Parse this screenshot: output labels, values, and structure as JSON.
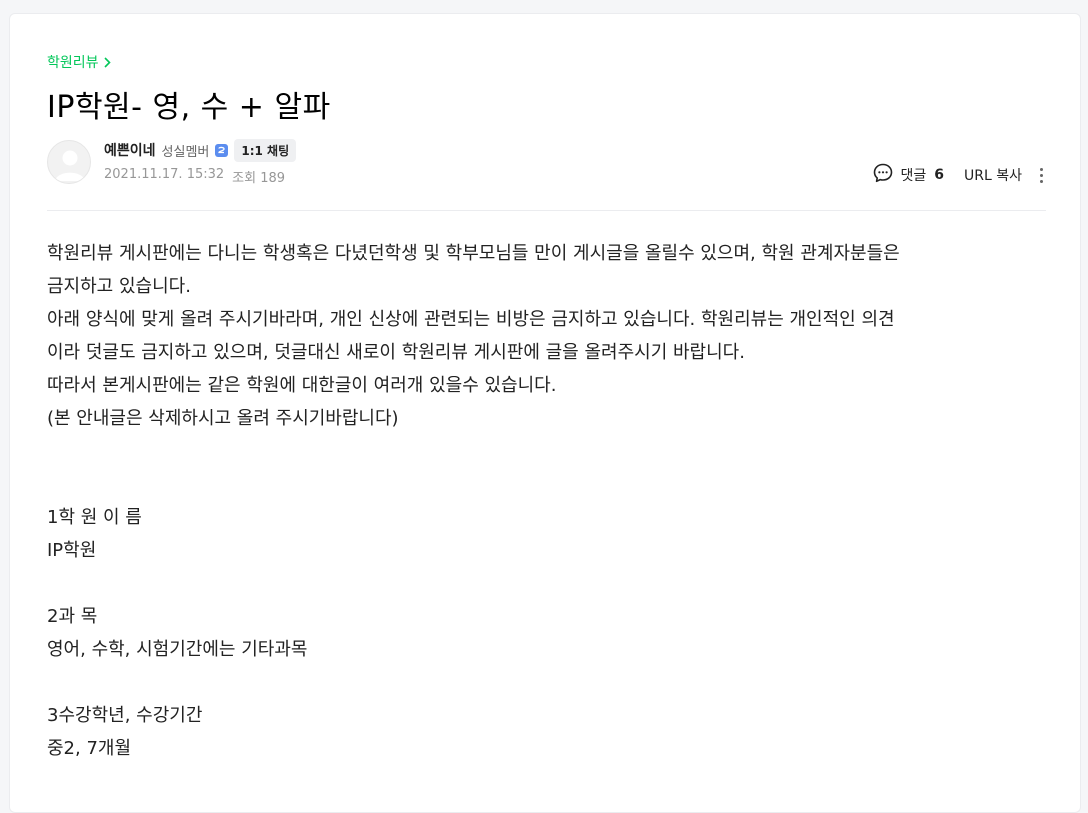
{
  "board": {
    "name": "학원리뷰"
  },
  "article": {
    "title": "IP학원- 영, 수 + 알파",
    "author": {
      "nickname": "예쁜이네",
      "level": "성실멤버",
      "chat_label": "1:1 채팅"
    },
    "date": "2021.11.17. 15:32",
    "views": "조회 189"
  },
  "tools": {
    "comment_label": "댓글",
    "comment_count": "6",
    "url_copy_label": "URL 복사"
  },
  "content": {
    "lines": [
      "학원리뷰 게시판에는 다니는 학생혹은 다녔던학생 및 학부모님들 만이 게시글을 올릴수 있으며, 학원 관계자분들은",
      "금지하고 있습니다.",
      "아래 양식에 맞게 올려 주시기바라며, 개인 신상에 관련되는 비방은 금지하고 있습니다. 학원리뷰는 개인적인 의견",
      "이라 덧글도 금지하고 있으며, 덧글대신 새로이 학원리뷰 게시판에 글을 올려주시기 바랍니다.",
      "따라서 본게시판에는 같은 학원에 대한글이 여러개 있을수 있습니다.",
      "(본 안내글은 삭제하시고 올려 주시기바랍니다)",
      "",
      "",
      "1학 원 이 름",
      "IP학원",
      "",
      "2과 목",
      "영어, 수학, 시험기간에는 기타과목",
      "",
      "3수강학년, 수강기간",
      "중2, 7개월"
    ]
  },
  "colors": {
    "accent": "#03c75a",
    "text": "#222222",
    "meta": "#979797",
    "level_badge": "#5b8def"
  },
  "icons": {
    "board_chevron": "chevron-right-icon",
    "avatar": "default-avatar-icon",
    "level": "level-badge-icon",
    "comment": "comment-bubble-icon",
    "more": "more-vertical-icon"
  }
}
